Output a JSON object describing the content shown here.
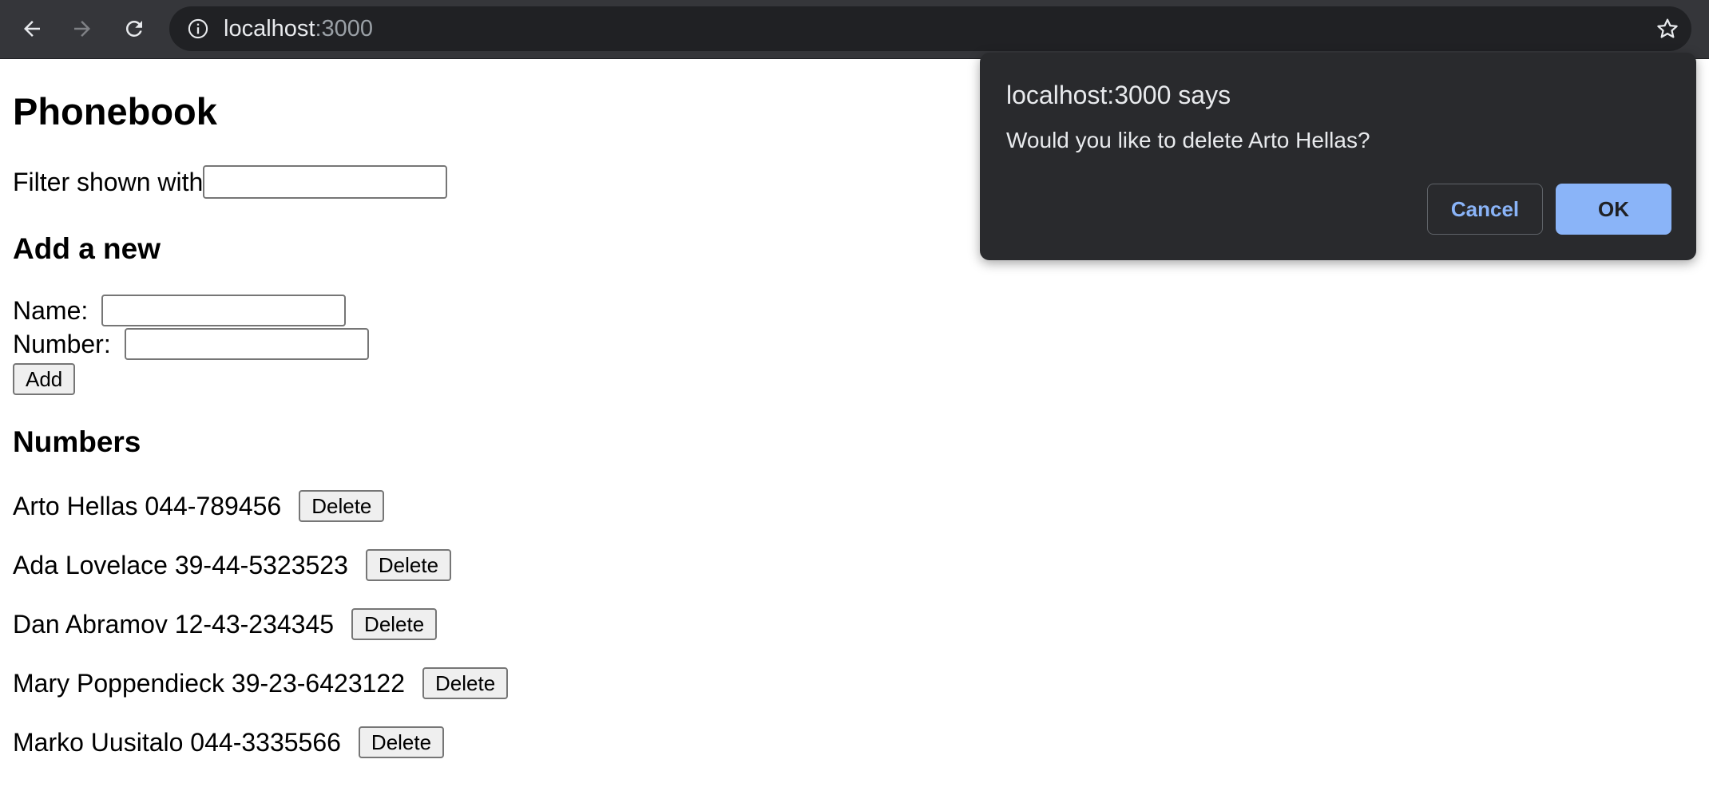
{
  "browser": {
    "url_host": "localhost",
    "url_port": ":3000",
    "icons": [
      "back-arrow-icon",
      "forward-arrow-icon",
      "reload-icon",
      "info-icon",
      "star-icon"
    ]
  },
  "app": {
    "title": "Phonebook",
    "filter_label": "Filter shown with",
    "filter_value": "",
    "add_heading": "Add a new",
    "name_label": "Name: ",
    "name_value": "",
    "number_label": "Number: ",
    "number_value": "",
    "add_button": "Add",
    "numbers_heading": "Numbers",
    "entries": [
      {
        "text": "Arto Hellas 044-789456",
        "button": "Delete"
      },
      {
        "text": "Ada Lovelace 39-44-5323523",
        "button": "Delete"
      },
      {
        "text": "Dan Abramov 12-43-234345",
        "button": "Delete"
      },
      {
        "text": "Mary Poppendieck 39-23-6423122",
        "button": "Delete"
      },
      {
        "text": "Marko Uusitalo 044-3335566",
        "button": "Delete"
      }
    ]
  },
  "dialog": {
    "title": "localhost:3000 says",
    "message": "Would you like to delete Arto Hellas?",
    "cancel": "Cancel",
    "ok": "OK",
    "colors": {
      "background": "#292a2d",
      "accent": "#8ab4f8"
    }
  }
}
